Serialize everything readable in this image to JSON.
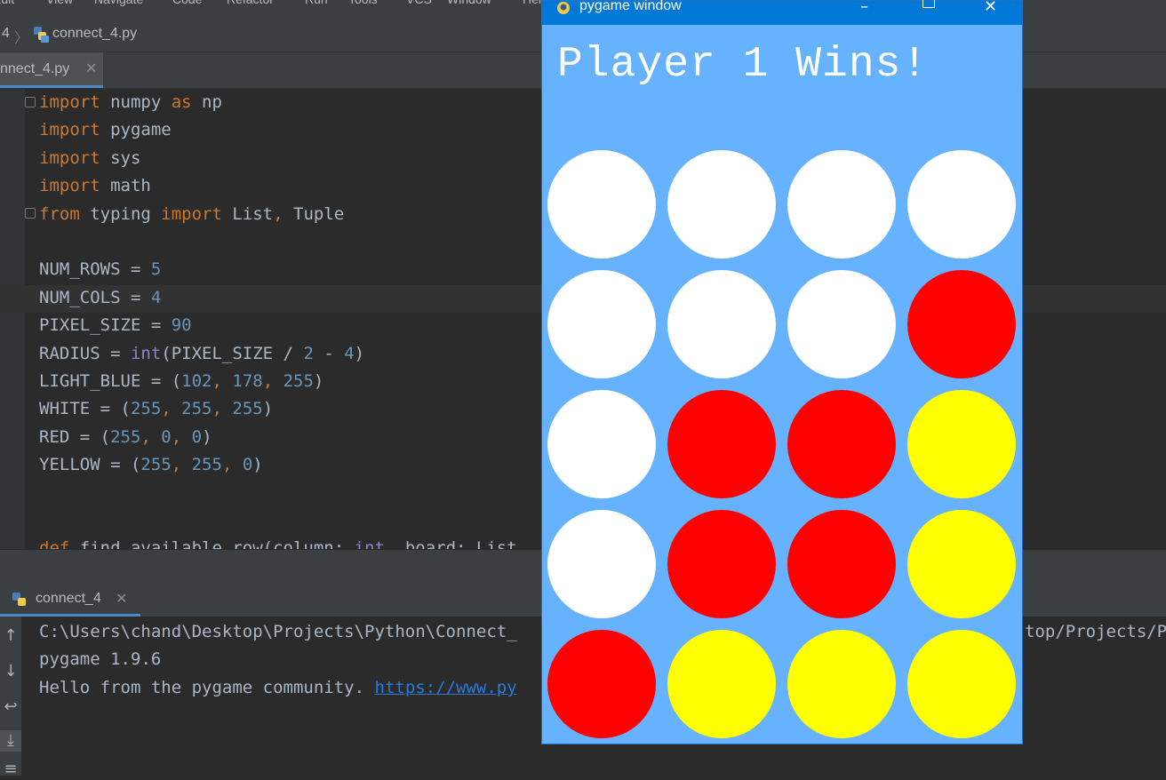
{
  "ide": {
    "menu": [
      "Edit",
      "View",
      "Navigate",
      "Code",
      "Refactor",
      "Run",
      "Tools",
      "VCS",
      "Window",
      "Help"
    ],
    "breadcrumb": {
      "project": "4",
      "file": "connect_4.py"
    },
    "editor_tab": {
      "label": "nnect_4.py"
    },
    "code_lines": [
      [
        [
          "kw",
          "import"
        ],
        [
          "t",
          " numpy "
        ],
        [
          "kw",
          "as"
        ],
        [
          "t",
          " np"
        ]
      ],
      [
        [
          "kw",
          "import"
        ],
        [
          "t",
          " pygame"
        ]
      ],
      [
        [
          "kw",
          "import"
        ],
        [
          "t",
          " sys"
        ]
      ],
      [
        [
          "kw",
          "import"
        ],
        [
          "t",
          " math"
        ]
      ],
      [
        [
          "kw",
          "from"
        ],
        [
          "t",
          " typing "
        ],
        [
          "kw",
          "import"
        ],
        [
          "t",
          " List"
        ],
        [
          "kw",
          ","
        ],
        [
          "t",
          " Tuple"
        ]
      ],
      [],
      [
        [
          "t",
          "NUM_ROWS = "
        ],
        [
          "num",
          "5"
        ]
      ],
      [
        [
          "t",
          "NUM_COLS = "
        ],
        [
          "num",
          "4"
        ]
      ],
      [
        [
          "t",
          "PIXEL_SIZE = "
        ],
        [
          "num",
          "90"
        ]
      ],
      [
        [
          "t",
          "RADIUS = "
        ],
        [
          "bi",
          "int"
        ],
        [
          "t",
          "(PIXEL_SIZE / "
        ],
        [
          "num",
          "2"
        ],
        [
          "t",
          " - "
        ],
        [
          "num",
          "4"
        ],
        [
          "t",
          ")"
        ]
      ],
      [
        [
          "t",
          "LIGHT_BLUE = ("
        ],
        [
          "num",
          "102"
        ],
        [
          "kw",
          ", "
        ],
        [
          "num",
          "178"
        ],
        [
          "kw",
          ", "
        ],
        [
          "num",
          "255"
        ],
        [
          "t",
          ")"
        ]
      ],
      [
        [
          "t",
          "WHITE = ("
        ],
        [
          "num",
          "255"
        ],
        [
          "kw",
          ", "
        ],
        [
          "num",
          "255"
        ],
        [
          "kw",
          ", "
        ],
        [
          "num",
          "255"
        ],
        [
          "t",
          ")"
        ]
      ],
      [
        [
          "t",
          "RED = ("
        ],
        [
          "num",
          "255"
        ],
        [
          "kw",
          ", "
        ],
        [
          "num",
          "0"
        ],
        [
          "kw",
          ", "
        ],
        [
          "num",
          "0"
        ],
        [
          "t",
          ")"
        ]
      ],
      [
        [
          "t",
          "YELLOW = ("
        ],
        [
          "num",
          "255"
        ],
        [
          "kw",
          ", "
        ],
        [
          "num",
          "255"
        ],
        [
          "kw",
          ", "
        ],
        [
          "num",
          "0"
        ],
        [
          "t",
          ")"
        ]
      ],
      [],
      [],
      [
        [
          "kw",
          "def"
        ],
        [
          "t",
          " find_available_row(column: "
        ],
        [
          "bi",
          "int"
        ],
        [
          "t",
          ", board: List"
        ]
      ]
    ],
    "run_tab": {
      "label": "connect_4"
    },
    "console": {
      "line1": "C:\\Users\\chand\\Desktop\\Projects\\Python\\Connect_",
      "line1_right": "top/Projects/P",
      "line2": "pygame 1.9.6",
      "line3_text": "Hello from the pygame community. ",
      "line3_link": "https://www.py"
    },
    "colors": {
      "keyword": "#cc7832",
      "number": "#6897bb",
      "builtin": "#8888c6",
      "text": "#a9b7c6",
      "link": "#287bde"
    }
  },
  "pygame": {
    "title": "pygame window",
    "message": "Player 1 Wins!",
    "colors": {
      "background": "#66b2ff",
      "WHITE": "#ffffff",
      "RED": "#ff0000",
      "YELLOW": "#ffff00"
    },
    "board": [
      [
        "WHITE",
        "WHITE",
        "WHITE",
        "WHITE"
      ],
      [
        "WHITE",
        "WHITE",
        "WHITE",
        "RED"
      ],
      [
        "WHITE",
        "RED",
        "RED",
        "YELLOW"
      ],
      [
        "WHITE",
        "RED",
        "RED",
        "YELLOW"
      ],
      [
        "RED",
        "YELLOW",
        "YELLOW",
        "YELLOW"
      ]
    ]
  }
}
